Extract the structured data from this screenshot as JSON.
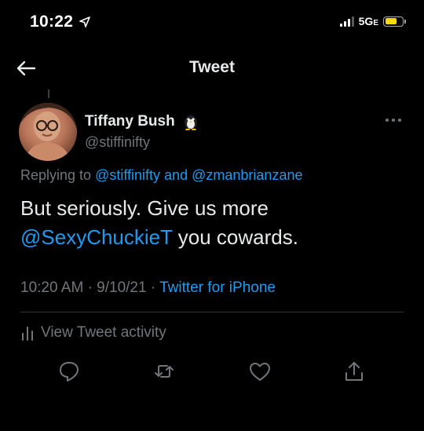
{
  "status_bar": {
    "time": "10:22",
    "network": "5G",
    "network_suffix": "E",
    "battery_color": "#f5d90a"
  },
  "header": {
    "title": "Tweet"
  },
  "tweet": {
    "author_name": "Tiffany Bush",
    "author_handle": "@stiffinifty",
    "replying_label": "Replying to",
    "replying_to_1": "@stiffinifty",
    "replying_and": "and",
    "replying_to_2": "@zmanbrianzane",
    "text_part1": "But seriously. Give us more",
    "text_mention": "@SexyChuckieT",
    "text_part2": "you cowards.",
    "time": "10:20 AM",
    "date": "9/10/21",
    "source": "Twitter for iPhone",
    "activity_label": "View Tweet activity"
  },
  "icons": {
    "back": "arrow-left-icon",
    "more": "more-horizontal-icon",
    "reply": "reply-icon",
    "retweet": "retweet-icon",
    "like": "heart-icon",
    "share": "share-icon",
    "activity": "analytics-icon"
  },
  "colors": {
    "accent": "#1d9bf0",
    "secondary_text": "#71767b",
    "primary_text": "#e7e9ea",
    "divider": "#2f3336"
  }
}
